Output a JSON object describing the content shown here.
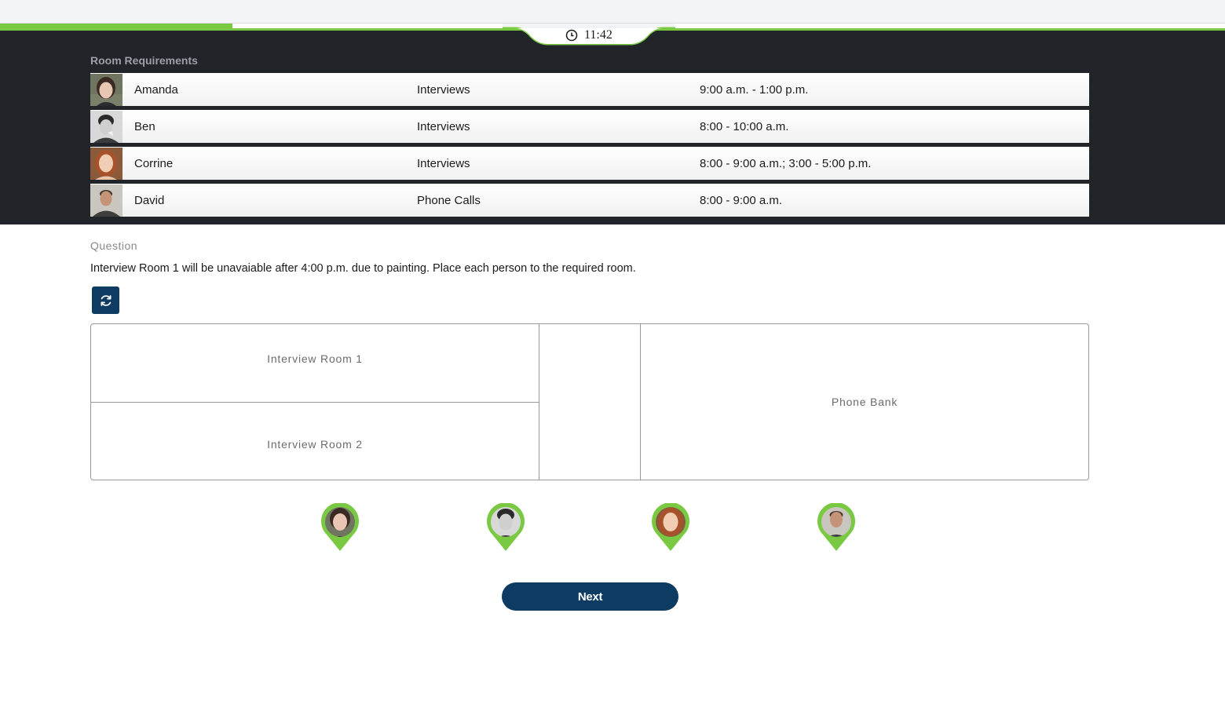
{
  "timer": {
    "text": "11:42",
    "icon": "clock-icon"
  },
  "progress": {
    "fraction": 0.19
  },
  "requirements": {
    "title": "Room Requirements",
    "rows": [
      {
        "name": "Amanda",
        "task": "Interviews",
        "time": "9:00 a.m. - 1:00 p.m."
      },
      {
        "name": "Ben",
        "task": "Interviews",
        "time": "8:00 - 10:00 a.m."
      },
      {
        "name": "Corrine",
        "task": "Interviews",
        "time": "8:00 - 9:00 a.m.; 3:00 - 5:00 p.m."
      },
      {
        "name": "David",
        "task": "Phone Calls",
        "time": "8:00 - 9:00 a.m."
      }
    ]
  },
  "question": {
    "label": "Question",
    "text": "Interview Room 1 will be unavaiable after 4:00 p.m. due to painting. Place each person to the required room."
  },
  "reset": {
    "icon": "refresh-icon"
  },
  "rooms": {
    "room1": "Interview Room 1",
    "room2": "Interview Room 2",
    "phone": "Phone Bank"
  },
  "colors": {
    "accent": "#7ac943",
    "primary": "#0d3b62",
    "dark_band": "#212429"
  },
  "actions": {
    "next_label": "Next"
  }
}
